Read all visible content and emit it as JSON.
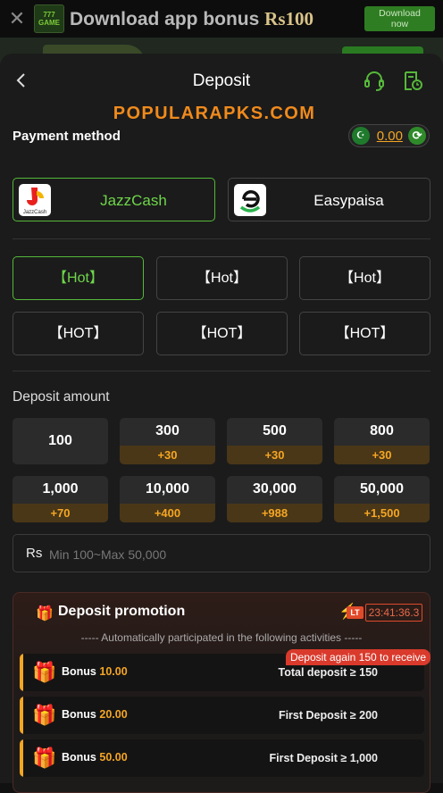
{
  "banner": {
    "close": "✕",
    "logo_line1": "777",
    "logo_line2": "GAME",
    "title": "Download app bonus ",
    "title_amount": "Rs100",
    "download_line1": "Download",
    "download_line2": "now"
  },
  "header": {
    "title": "Deposit"
  },
  "watermark": "POPULARAPKS.COM",
  "payment": {
    "label": "Payment method",
    "balance": "0.00",
    "flag_glyph": "☪",
    "refresh_glyph": "⟳",
    "methods": [
      {
        "name": "JazzCash",
        "icon_text": "JazzCash",
        "selected": true
      },
      {
        "name": "Easypaisa",
        "icon_text": "e",
        "selected": false
      }
    ],
    "channels": [
      "【Hot】",
      "【Hot】",
      "【Hot】",
      "【HOT】",
      "【HOT】",
      "【HOT】"
    ]
  },
  "amount": {
    "label": "Deposit amount",
    "options": [
      {
        "value": "100",
        "bonus": ""
      },
      {
        "value": "300",
        "bonus": "+30"
      },
      {
        "value": "500",
        "bonus": "+30"
      },
      {
        "value": "800",
        "bonus": "+30"
      },
      {
        "value": "1,000",
        "bonus": "+70"
      },
      {
        "value": "10,000",
        "bonus": "+400"
      },
      {
        "value": "30,000",
        "bonus": "+988"
      },
      {
        "value": "50,000",
        "bonus": "+1,500"
      }
    ],
    "currency": "Rs",
    "placeholder": "Min 100~Max 50,000"
  },
  "promotion": {
    "title": "Deposit promotion",
    "gift": "🎁",
    "lt": "LT",
    "timer": "23:41:36.3",
    "note": "----- Automatically participated in the following activities -----",
    "tag": "Deposit again 150 to receive",
    "rows": [
      {
        "label": "Bonus",
        "amount": "10.00",
        "condition": "Total deposit ≥ 150",
        "icon": "🎁"
      },
      {
        "label": "Bonus",
        "amount": "20.00",
        "condition": "First Deposit ≥ 200",
        "icon": "🎁"
      },
      {
        "label": "Bonus",
        "amount": "50.00",
        "condition": "First Deposit ≥ 1,000",
        "icon": "🎁"
      }
    ]
  },
  "colors": {
    "accent_green": "#56b83a",
    "accent_orange": "#f5a623",
    "alert_red": "#d93a2c"
  }
}
